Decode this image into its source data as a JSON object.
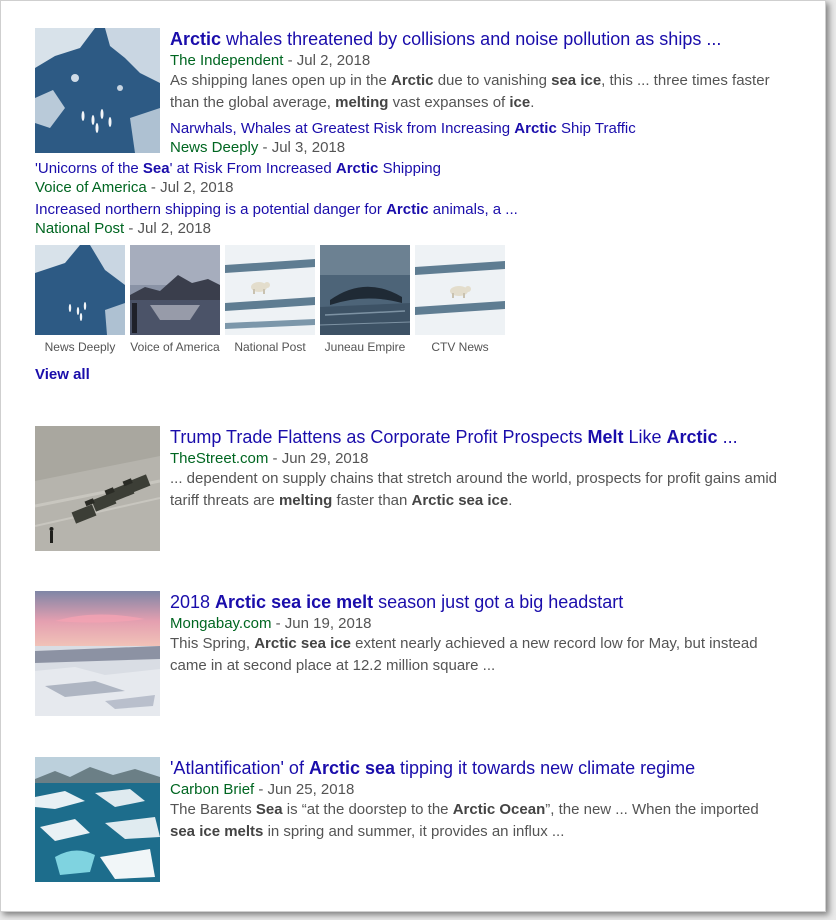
{
  "results": [
    {
      "title": [
        {
          "t": "Arctic",
          "b": true
        },
        {
          "t": " whales threatened by collisions and noise pollution as ships ...",
          "b": false
        }
      ],
      "source": "The Independent",
      "date": " - Jul 2, 2018",
      "snippet": [
        {
          "t": "As shipping lanes open up in the ",
          "b": false
        },
        {
          "t": "Arctic",
          "b": true
        },
        {
          "t": " due to vanishing ",
          "b": false
        },
        {
          "t": "sea ice",
          "b": true
        },
        {
          "t": ", this ... three times faster than the global average, ",
          "b": false
        },
        {
          "t": "melting",
          "b": true
        },
        {
          "t": " vast expanses of ",
          "b": false
        },
        {
          "t": "ice",
          "b": true
        },
        {
          "t": ".",
          "b": false
        }
      ],
      "thumb_icon": "narwhals-ice-photo"
    },
    {
      "title": [
        {
          "t": "Trump Trade Flattens as Corporate Profit Prospects ",
          "b": false
        },
        {
          "t": "Melt",
          "b": true
        },
        {
          "t": " Like ",
          "b": false
        },
        {
          "t": "Arctic",
          "b": true
        },
        {
          "t": " ...",
          "b": false
        }
      ],
      "source": "TheStreet.com",
      "date": " - Jun 29, 2018",
      "snippet": [
        {
          "t": "... dependent on supply chains that stretch around the world, prospects for profit gains amid tariff threats are ",
          "b": false
        },
        {
          "t": "melting",
          "b": true
        },
        {
          "t": " faster than ",
          "b": false
        },
        {
          "t": "Arctic sea ice",
          "b": true
        },
        {
          "t": ".",
          "b": false
        }
      ],
      "thumb_icon": "tanks-photo"
    },
    {
      "title": [
        {
          "t": "2018 ",
          "b": false
        },
        {
          "t": "Arctic sea ice melt",
          "b": true
        },
        {
          "t": " season just got a big headstart",
          "b": false
        }
      ],
      "source": "Mongabay.com",
      "date": " - Jun 19, 2018",
      "snippet": [
        {
          "t": "This Spring, ",
          "b": false
        },
        {
          "t": "Arctic sea ice",
          "b": true
        },
        {
          "t": " extent nearly achieved a new record low for May, but instead came in at second place at 12.2 million square ...",
          "b": false
        }
      ],
      "thumb_icon": "sunset-ice-photo"
    },
    {
      "title": [
        {
          "t": "'Atlantification' of ",
          "b": false
        },
        {
          "t": "Arctic sea",
          "b": true
        },
        {
          "t": " tipping it towards new climate regime",
          "b": false
        }
      ],
      "source": "Carbon Brief",
      "date": " - Jun 25, 2018",
      "snippet": [
        {
          "t": "The Barents ",
          "b": false
        },
        {
          "t": "Sea",
          "b": true
        },
        {
          "t": " is “at the doorstep to the ",
          "b": false
        },
        {
          "t": "Arctic Ocean",
          "b": true
        },
        {
          "t": "”, the new ... When the imported ",
          "b": false
        },
        {
          "t": "sea ice melts",
          "b": true
        },
        {
          "t": " in spring and summer, it provides an influx ...",
          "b": false
        }
      ],
      "thumb_icon": "sea-ice-floes-photo"
    }
  ],
  "related": [
    {
      "title": [
        {
          "t": "Narwhals, Whales at Greatest Risk from Increasing ",
          "b": false
        },
        {
          "t": "Arctic",
          "b": true
        },
        {
          "t": " Ship Traffic",
          "b": false
        }
      ],
      "source": "News Deeply",
      "date": " - Jul 3, 2018"
    },
    {
      "title": [
        {
          "t": "'Unicorns of the ",
          "b": false
        },
        {
          "t": "Sea",
          "b": true
        },
        {
          "t": "' at Risk From Increased ",
          "b": false
        },
        {
          "t": "Arctic",
          "b": true
        },
        {
          "t": " Shipping",
          "b": false
        }
      ],
      "source": "Voice of America",
      "date": " - Jul 2, 2018"
    },
    {
      "title": [
        {
          "t": "Increased northern shipping is a potential danger for ",
          "b": false
        },
        {
          "t": "Arctic",
          "b": true
        },
        {
          "t": " animals, a ...",
          "b": false
        }
      ],
      "source": "National Post",
      "date": " - Jul 2, 2018"
    }
  ],
  "strip": [
    {
      "label": "News Deeply",
      "icon": "narwhals-ice-photo"
    },
    {
      "label": "Voice of America",
      "icon": "fjord-mountains-photo"
    },
    {
      "label": "National Post",
      "icon": "polar-bear-photo"
    },
    {
      "label": "Juneau Empire",
      "icon": "whale-photo"
    },
    {
      "label": "CTV News",
      "icon": "polar-bear-photo"
    }
  ],
  "view_all": "View all",
  "colors": {
    "link": "#1a0dab",
    "source": "#006621",
    "text": "#545454"
  }
}
